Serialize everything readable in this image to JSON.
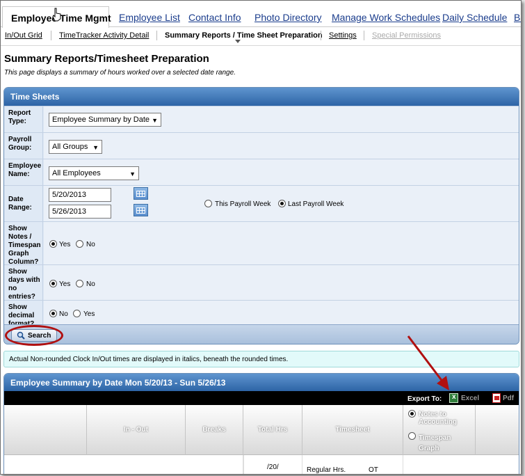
{
  "tabs": [
    {
      "label": "Employee Time Mgmt",
      "active": true
    },
    {
      "label": "Employee List"
    },
    {
      "label": "Contact Info"
    },
    {
      "label": "Photo Directory"
    },
    {
      "label": "Manage Work Schedules"
    },
    {
      "label": "Daily Schedule"
    },
    {
      "label": "Bio"
    }
  ],
  "subnav": [
    {
      "label": "In/Out Grid",
      "state": "link"
    },
    {
      "label": "TimeTracker Activity Detail",
      "state": "link"
    },
    {
      "label": "Summary Reports / Time Sheet Preparation",
      "state": "active"
    },
    {
      "label": "Settings",
      "state": "link"
    },
    {
      "label": "Special Permissions",
      "state": "disabled"
    }
  ],
  "page": {
    "title": "Summary Reports/Timesheet Preparation",
    "description": "This page displays a summary of hours worked over a selected date range."
  },
  "timesheets": {
    "header": "Time Sheets",
    "report_type": {
      "label": "Report Type:",
      "value": "Employee Summary by Date"
    },
    "payroll_group": {
      "label": "Payroll Group:",
      "value": "All Groups"
    },
    "employee_name": {
      "label": "Employee Name:",
      "value": "All Employees"
    },
    "date_range": {
      "label": "Date Range:",
      "start": "5/20/2013",
      "end": "5/26/2013",
      "opt_this": "This Payroll Week",
      "opt_last": "Last Payroll Week",
      "selected": "last"
    },
    "show_notes": {
      "label": "Show Notes / Timespan Graph Column?",
      "opt1": "Yes",
      "opt2": "No",
      "selected": "Yes"
    },
    "show_days": {
      "label": "Show days with no entries?",
      "opt1": "Yes",
      "opt2": "No",
      "selected": "Yes"
    },
    "show_decimal": {
      "label": "Show decimal format?",
      "opt1": "No",
      "opt2": "Yes",
      "selected": "No"
    },
    "search_label": "Search"
  },
  "notice": "Actual Non-rounded Clock In/Out times are displayed in italics, beneath the rounded times.",
  "summary": {
    "header": "Employee Summary by Date Mon 5/20/13 - Sun 5/26/13",
    "export_label": "Export To:",
    "excel": "Excel",
    "pdf": "Pdf",
    "columns": [
      "In - Out",
      "Breaks",
      "Total Hrs",
      "Timesheet"
    ],
    "notes_option": "Notes to Accounting",
    "timespan_option": "Timespan Graph",
    "row_partial": "/20/",
    "regular": "Regular Hrs.",
    "ot": "OT"
  },
  "colors": {
    "accent": "#2d64a6",
    "annotation": "#b01010",
    "notice_bg": "#e2fafa"
  }
}
